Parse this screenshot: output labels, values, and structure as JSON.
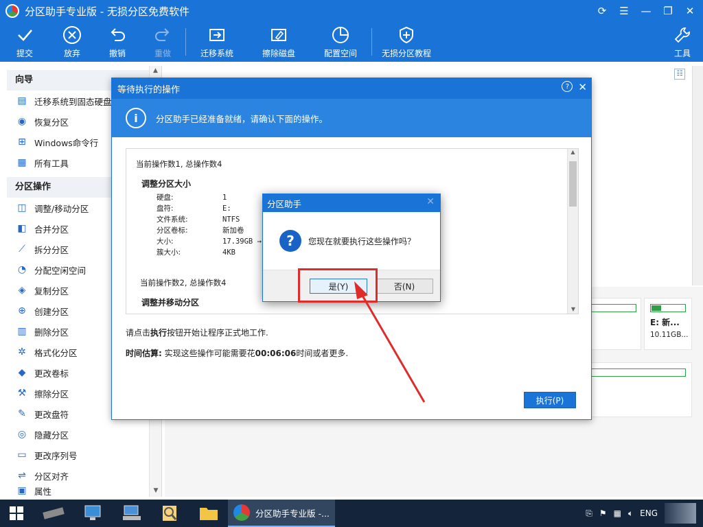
{
  "window": {
    "title": "分区助手专业版 - 无损分区免费软件"
  },
  "toolbar": {
    "items": [
      {
        "label": "提交",
        "icon": "check-icon"
      },
      {
        "label": "放弃",
        "icon": "cancel-circle-icon"
      },
      {
        "label": "撤销",
        "icon": "undo-icon"
      },
      {
        "label": "重做",
        "icon": "redo-icon"
      },
      {
        "label": "迁移系统",
        "icon": "migrate-os-icon"
      },
      {
        "label": "擦除磁盘",
        "icon": "wipe-disk-icon"
      },
      {
        "label": "配置空间",
        "icon": "pie-icon"
      },
      {
        "label": "无损分区教程",
        "icon": "shield-icon"
      },
      {
        "label": "工具",
        "icon": "wrench-icon"
      }
    ]
  },
  "sidebar": {
    "wizard_title": "向导",
    "wizard_items": [
      "迁移系统到固态硬盘",
      "恢复分区",
      "Windows命令行",
      "所有工具"
    ],
    "ops_title": "分区操作",
    "ops_items": [
      "调整/移动分区",
      "合并分区",
      "拆分分区",
      "分配空闲空间",
      "复制分区",
      "创建分区",
      "删除分区",
      "格式化分区",
      "更改卷标",
      "擦除分区",
      "更改盘符",
      "隐藏分区",
      "更改序列号",
      "分区对齐",
      "属性"
    ]
  },
  "disk_panel": {
    "card_label": "E: 新...",
    "card_size": "10.11GB..."
  },
  "pending_dialog": {
    "title": "等待执行的操作",
    "banner": "分区助手已经准备就绪，请确认下面的操作。",
    "op1_header": "当前操作数1, 总操作数4",
    "op1_title": "调整分区大小",
    "op1_rows": [
      {
        "k": "硬盘:",
        "v": "1"
      },
      {
        "k": "盘符:",
        "v": "E:"
      },
      {
        "k": "文件系统:",
        "v": "NTFS"
      },
      {
        "k": "分区卷标:",
        "v": "新加卷"
      },
      {
        "k": "大小:",
        "v": "17.39GB →"
      },
      {
        "k": "簇大小:",
        "v": "4KB"
      }
    ],
    "op2_header": "当前操作数2, 总操作数4",
    "op2_title": "调整并移动分区",
    "hint_prefix": "请点击",
    "hint_bold": "执行",
    "hint_suffix": "按钮开始让程序正式地工作.",
    "estimate_label": "时间估算:",
    "estimate_prefix": "实现这些操作可能需要花",
    "estimate_time": "00:06:06",
    "estimate_suffix": "时间或者更多.",
    "execute_button": "执行(P)"
  },
  "confirm_dialog": {
    "title": "分区助手",
    "message": "您现在就要执行这些操作吗？",
    "yes": "是(Y)",
    "no": "否(N)"
  },
  "taskbar": {
    "active_app": "分区助手专业版 -...",
    "lang": "ENG"
  },
  "colors": {
    "accent": "#1a73d6",
    "highlight": "#e02b2b",
    "taskbar": "#14243b"
  }
}
